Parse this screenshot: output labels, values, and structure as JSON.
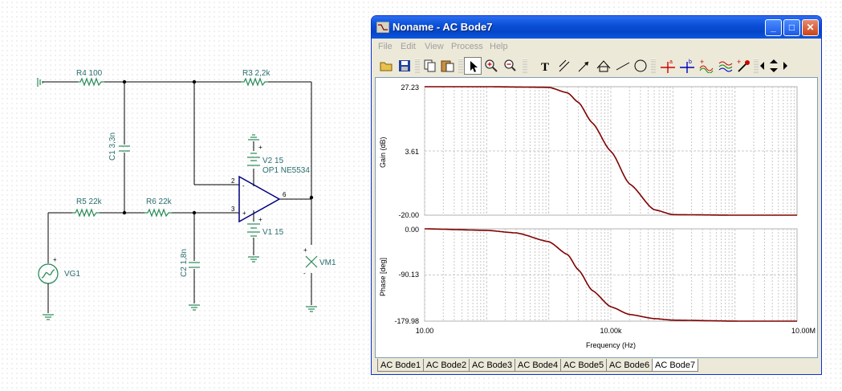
{
  "schematic": {
    "labels": {
      "r4": "R4 100",
      "r3": "R3 2,2k",
      "c1": "C1 3,3n",
      "v2": "V2 15",
      "op1": "OP1 NE5534",
      "r5": "R5 22k",
      "r6": "R6 22k",
      "c2": "C2 1,8n",
      "v1": "V1 15",
      "vm1": "VM1",
      "vg1": "VG1"
    },
    "pins": {
      "p2": "2",
      "p3": "3",
      "p6": "6",
      "minus": "-",
      "plus": "+"
    }
  },
  "window": {
    "title": "Noname - AC Bode7",
    "controls": {
      "minimize": "_",
      "maximize": "□",
      "close": "✕"
    },
    "menu": [
      "File",
      "Edit",
      "View",
      "Process",
      "Help"
    ]
  },
  "toolbar_icons": [
    "open-icon",
    "save-icon",
    "copy-icon",
    "paste-icon",
    "pointer-icon",
    "zoom-in-icon",
    "zoom-100-icon",
    "text-icon",
    "line-icon",
    "arrow-icon",
    "box-icon",
    "draw-line-icon",
    "circle-icon",
    "cursor-a-icon",
    "cursor-b-icon",
    "add-curve-icon",
    "waves-icon",
    "probe-icon",
    "nav-arrows-icon"
  ],
  "gain_plot": {
    "ylabel": "Gain (dB)",
    "yticks": [
      "27.23",
      "3.61",
      "-20.00"
    ]
  },
  "phase_plot": {
    "ylabel": "Phase [deg]",
    "yticks": [
      "0.00",
      "-90.13",
      "-179.98"
    ]
  },
  "xaxis": {
    "label": "Frequency (Hz)",
    "ticks": [
      "10.00",
      "10.00k",
      "10.00M"
    ]
  },
  "chart_data": [
    {
      "type": "line",
      "x_scale": "log",
      "xlim": [
        10,
        10000000
      ],
      "ylim": [
        -20,
        27.23
      ],
      "ylabel": "Gain (dB)",
      "xlabel": "Frequency (Hz)",
      "grid": true,
      "series": [
        {
          "x": [
            10,
            100,
            1000,
            2000,
            3000,
            5000,
            10000,
            20000,
            50000,
            100000,
            1000000,
            10000000
          ],
          "y": [
            27.23,
            27.23,
            27.0,
            25.0,
            21.5,
            14.0,
            3.5,
            -8.5,
            -18.0,
            -19.8,
            -20.0,
            -20.0
          ],
          "color": "#800000"
        }
      ]
    },
    {
      "type": "line",
      "x_scale": "log",
      "xlim": [
        10,
        10000000
      ],
      "ylim": [
        -179.98,
        0
      ],
      "ylabel": "Phase [deg]",
      "xlabel": "Frequency (Hz)",
      "grid": true,
      "series": [
        {
          "x": [
            10,
            100,
            300,
            1000,
            2000,
            3000,
            5000,
            10000,
            20000,
            50000,
            100000,
            1000000,
            10000000
          ],
          "y": [
            0,
            -3,
            -8,
            -25,
            -50,
            -80,
            -120,
            -152,
            -167,
            -175,
            -178,
            -179.9,
            -179.98
          ],
          "color": "#800000"
        }
      ]
    }
  ],
  "tabs": [
    "AC Bode1",
    "AC Bode2",
    "AC Bode3",
    "AC Bode4",
    "AC Bode5",
    "AC Bode6",
    "AC Bode7"
  ],
  "active_tab": "AC Bode7"
}
